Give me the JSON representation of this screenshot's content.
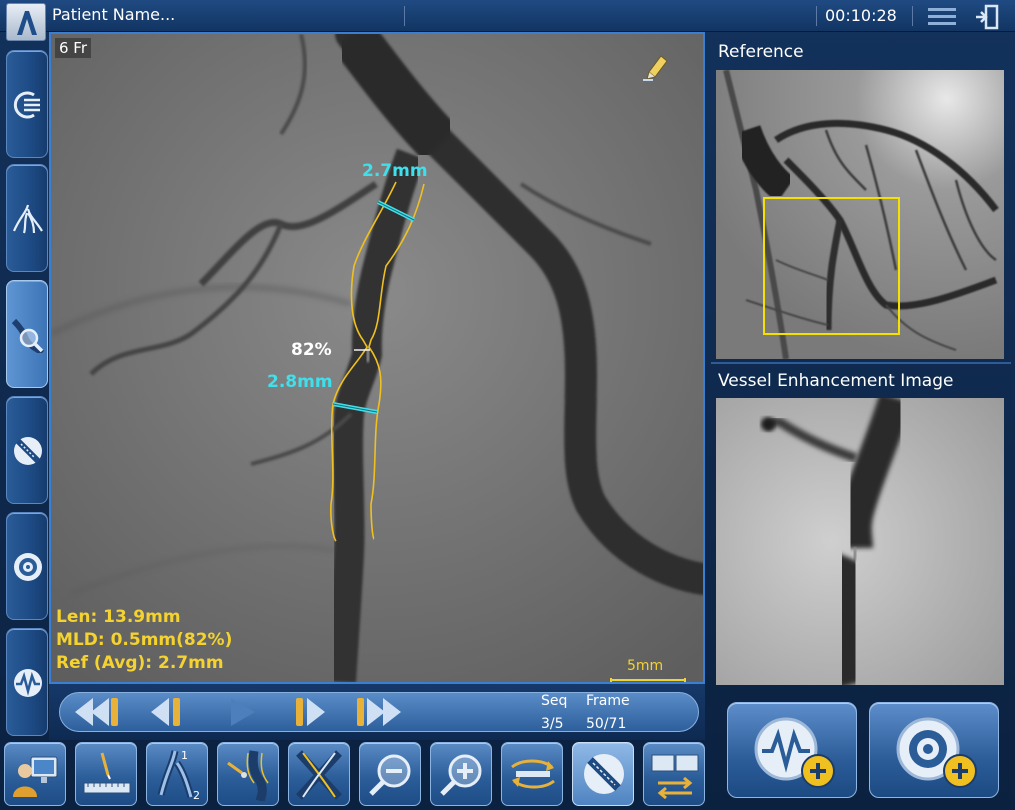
{
  "header": {
    "patient_name": "Patient Name...",
    "timer": "00:10:28",
    "logo_icon": "philips-logo",
    "menu_icon": "menu-lines-icon",
    "exit_icon": "exit-door-icon"
  },
  "left_rail": [
    {
      "name": "acquisition-icon",
      "active": false
    },
    {
      "name": "vessel-tree-icon",
      "active": false
    },
    {
      "name": "qca-analysis-icon",
      "active": true
    },
    {
      "name": "stent-icon",
      "active": false
    },
    {
      "name": "target-icon",
      "active": false
    },
    {
      "name": "waveform-icon",
      "active": false
    }
  ],
  "viewer": {
    "catheter_size": "6 Fr",
    "measurements": {
      "top_diameter": "2.7mm",
      "stenosis": "82%",
      "bottom_diameter": "2.8mm"
    },
    "stats": {
      "length": "Len: 13.9mm",
      "mld": "MLD: 0.5mm(82%)",
      "ref_avg": "Ref (Avg): 2.7mm"
    },
    "scale_bar": "5mm"
  },
  "playback": {
    "seq_label": "Seq",
    "frame_label": "Frame",
    "seq_value": "3/5",
    "frame_value": "50/71"
  },
  "toolbar": [
    "patient-workstation-icon",
    "catheter-calibration-icon",
    "vessel-segment-icon",
    "contour-edit-icon",
    "crossover-icon",
    "zoom-out-icon",
    "zoom-in-icon",
    "swap-images-icon",
    "stent-view-icon",
    "multi-display-icon"
  ],
  "right_panel": {
    "reference_title": "Reference",
    "vessel_enhancement_title": "Vessel Enhancement Image"
  },
  "colors": {
    "measurement_cyan": "#3fe0ec",
    "stats_yellow": "#f4d230",
    "contour_yellow": "#f0c020",
    "roi_box": "#f5e000",
    "accent_blue": "#3b7fd2"
  }
}
